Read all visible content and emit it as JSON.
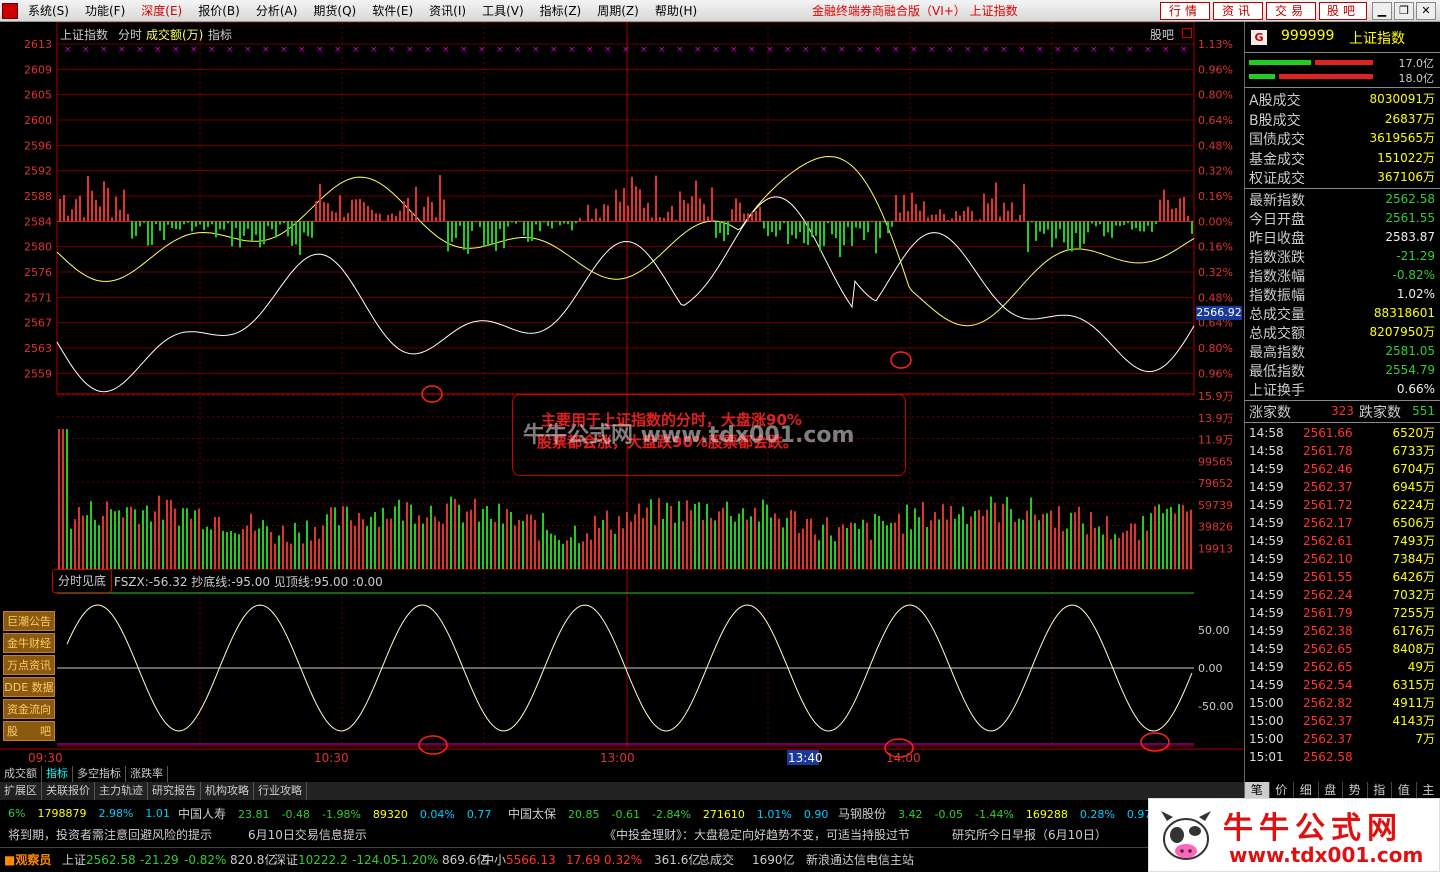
{
  "app": {
    "title": "金融终端券商融合版（VI+） 上证指数",
    "menus": [
      "系统(S)",
      "功能(F)",
      "深度(E)",
      "报价(B)",
      "分析(A)",
      "期货(Q)",
      "软件(E)",
      "资讯(I)",
      "工具(V)",
      "指标(Z)",
      "周期(Z)",
      "帮助(H)"
    ],
    "right_buttons": [
      "行情",
      "资讯",
      "交易",
      "股吧"
    ]
  },
  "chart": {
    "header": {
      "name": "上证指数",
      "period": "分时",
      "indicator_a": "成交额(万)",
      "indicator_b": "指标",
      "guba": "股吧"
    },
    "price_labels": [
      "2613",
      "2609",
      "2605",
      "2600",
      "2596",
      "2592",
      "2588",
      "2584",
      "2580",
      "2576",
      "2571",
      "2567",
      "2563",
      "2559"
    ],
    "pct_labels": [
      "1.13%",
      "0.96%",
      "0.80%",
      "0.64%",
      "0.48%",
      "0.32%",
      "0.16%",
      "0.00%",
      "0.16%",
      "0.32%",
      "0.48%",
      "0.64%",
      "0.80%",
      "0.96%"
    ],
    "current_price_tag": "2566.92",
    "volume_labels": [
      "15.9万",
      "13.9万",
      "11.9万",
      "99565",
      "79652",
      "59739",
      "39826",
      "19913"
    ],
    "indicator_labels": [
      "50.00",
      "0.00",
      "-50.00"
    ],
    "indicator_title": "分时见底",
    "indicator_values": "FSZX:-56.32  抄底线:-95.00  见顶线:95.00  :0.00",
    "time_labels": [
      "09:30",
      "10:30",
      "13:00",
      "13:40",
      "14:00"
    ],
    "annotation": {
      "line1": "主要用于上证指数的分时，大盘涨90%",
      "line2": "股票都会涨，大盘跌90%股票都会跌。"
    },
    "watermark": "牛牛公式网 www.tdx001.com",
    "side_tabs": [
      "巨潮公告",
      "金牛财经",
      "万点资讯",
      "DDE 数据",
      "资金流向",
      "股　　吧"
    ]
  },
  "right_panel": {
    "badge": "G",
    "code": "999999",
    "name": "上证指数",
    "ratio_up": "17.0亿",
    "ratio_down": "18.0亿",
    "volumes": [
      {
        "k": "A股成交",
        "v": "8030091万"
      },
      {
        "k": "B股成交",
        "v": "26837万"
      },
      {
        "k": "国债成交",
        "v": "3619565万"
      },
      {
        "k": "基金成交",
        "v": "151022万"
      },
      {
        "k": "权证成交",
        "v": "367106万"
      }
    ],
    "stats": [
      {
        "k": "最新指数",
        "v": "2562.58",
        "c": "green"
      },
      {
        "k": "今日开盘",
        "v": "2561.55",
        "c": "green"
      },
      {
        "k": "昨日收盘",
        "v": "2583.87",
        "c": "white"
      },
      {
        "k": "指数涨跌",
        "v": "-21.29",
        "c": "green"
      },
      {
        "k": "指数涨幅",
        "v": "-0.82%",
        "c": "green"
      },
      {
        "k": "指数振幅",
        "v": "1.02%",
        "c": "white"
      },
      {
        "k": "总成交量",
        "v": "88318601",
        "c": "yellow"
      },
      {
        "k": "总成交额",
        "v": "8207950万",
        "c": "yellow"
      },
      {
        "k": "最高指数",
        "v": "2581.05",
        "c": "green"
      },
      {
        "k": "最低指数",
        "v": "2554.79",
        "c": "green"
      },
      {
        "k": "上证换手",
        "v": "0.66%",
        "c": "white"
      }
    ],
    "breadth": {
      "up_label": "涨家数",
      "up": "323",
      "down_label": "跌家数",
      "down": "551"
    },
    "ticks": [
      {
        "t": "14:58",
        "p": "2561.66",
        "v": "6520万"
      },
      {
        "t": "14:58",
        "p": "2561.78",
        "v": "6733万"
      },
      {
        "t": "14:59",
        "p": "2562.46",
        "v": "6704万"
      },
      {
        "t": "14:59",
        "p": "2562.37",
        "v": "6945万"
      },
      {
        "t": "14:59",
        "p": "2561.72",
        "v": "6224万"
      },
      {
        "t": "14:59",
        "p": "2562.17",
        "v": "6506万"
      },
      {
        "t": "14:59",
        "p": "2562.61",
        "v": "7493万"
      },
      {
        "t": "14:59",
        "p": "2562.10",
        "v": "7384万"
      },
      {
        "t": "14:59",
        "p": "2561.55",
        "v": "6426万"
      },
      {
        "t": "14:59",
        "p": "2562.24",
        "v": "7032万"
      },
      {
        "t": "14:59",
        "p": "2561.79",
        "v": "7255万"
      },
      {
        "t": "14:59",
        "p": "2562.38",
        "v": "6176万"
      },
      {
        "t": "14:59",
        "p": "2562.65",
        "v": "8408万"
      },
      {
        "t": "14:59",
        "p": "2562.65",
        "v": "49万"
      },
      {
        "t": "14:59",
        "p": "2562.54",
        "v": "6315万"
      },
      {
        "t": "15:00",
        "p": "2562.82",
        "v": "4911万"
      },
      {
        "t": "15:00",
        "p": "2562.37",
        "v": "4143万"
      },
      {
        "t": "15:00",
        "p": "2562.37",
        "v": "7万"
      },
      {
        "t": "15:01",
        "p": "2562.58",
        "v": ""
      }
    ],
    "tabs": [
      "笔",
      "价",
      "细",
      "盘",
      "势",
      "指",
      "值",
      "主"
    ]
  },
  "bottom": {
    "tabs1": [
      "成交额",
      "指标",
      "多空指标",
      "涨跌率"
    ],
    "tabs2": [
      "扩展区",
      "关联报价",
      "主力轨迹",
      "研究报告",
      "机构攻略",
      "行业攻略"
    ],
    "stocks": [
      {
        "name": "",
        "a": "6%",
        "b": "1798879",
        "c": "2.98%",
        "d": "1.01"
      },
      {
        "name": "中国人寿",
        "a": "23.81",
        "b": "-0.48",
        "c": "-1.98%",
        "d": "89320",
        "e": "0.04%",
        "f": "0.77"
      },
      {
        "name": "中国太保",
        "a": "20.85",
        "b": "-0.61",
        "c": "-2.84%",
        "d": "271610",
        "e": "1.01%",
        "f": "0.90"
      },
      {
        "name": "马钢股份",
        "a": "3.42",
        "b": "-0.05",
        "c": "-1.44%",
        "d": "169288",
        "e": "0.28%",
        "f": "0.97"
      }
    ],
    "news": [
      "将到期，投资者需注意回避风险的提示",
      "6月10日交易信息提示",
      "《中投金理财》：大盘稳定向好趋势不变，可适当持股过节",
      "研究所今日早报（6月10日）"
    ],
    "status": {
      "guard": "观察员",
      "sh_label": "上证",
      "sh_val": "2562.58",
      "sh_chg": "-21.29",
      "sh_pct": "-0.82%",
      "sh_amt": "820.8亿",
      "sz_label": "深证",
      "sz_val": "10222.2",
      "sz_chg": "-124.05",
      "sz_pct": "-1.20%",
      "sz_amt": "869.6亿",
      "zx_label": "中小",
      "zx_val": "5566.13",
      "zx_chg": "17.69",
      "zx_pct": "0.32%",
      "zx_amt": "361.6亿",
      "total_label": "总成交",
      "total_val": "1690亿",
      "server": "新浪通达信电信主站"
    },
    "watermark": {
      "t1": "牛牛公式网",
      "t2": "www.tdx001.com"
    }
  }
}
